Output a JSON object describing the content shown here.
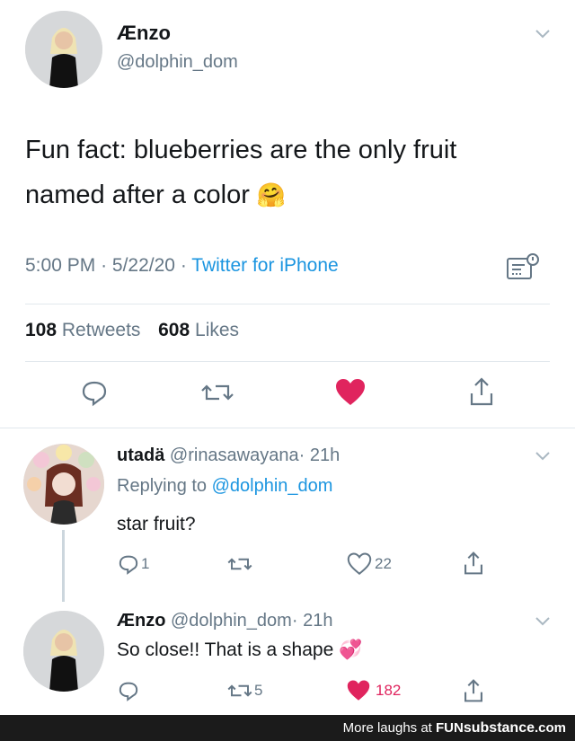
{
  "tweet": {
    "display_name": "Ænzo",
    "handle": "@dolphin_dom",
    "text_line1": "Fun fact: blueberries are the only fruit",
    "text_line2": "named after a color",
    "emoji": "🤗",
    "time": "5:00 PM",
    "sep1": "·",
    "date": "5/22/20",
    "sep2": "·",
    "source": "Twitter for iPhone",
    "retweets_count": "108",
    "retweets_label": "Retweets",
    "likes_count": "608",
    "likes_label": "Likes"
  },
  "replies": [
    {
      "name": "utadä",
      "handle": "@rinasawayana",
      "sep": "·",
      "time": "21h",
      "replying_prefix": "Replying to",
      "replying_handle": "@dolphin_dom",
      "text": "star fruit?",
      "reply_count": "1",
      "like_count": "22"
    },
    {
      "name": "Ænzo",
      "handle": "@dolphin_dom",
      "sep": "·",
      "time": "21h",
      "text": "So close!! That is a shape",
      "emoji": "💞",
      "retweet_count": "5",
      "like_count": "182"
    }
  ],
  "footer": {
    "prefix": "More laughs at ",
    "brand_fun": "FUN",
    "brand_substance": "substance",
    "brand_com": ".com"
  },
  "colors": {
    "like_red": "#e0245e",
    "link_blue": "#1b95e0",
    "muted_gray": "#657786",
    "footer_bg": "#1b1b1b"
  },
  "icons": [
    "chevron-down-icon",
    "reply-icon",
    "retweet-icon",
    "heart-icon",
    "share-icon",
    "analytics-icon"
  ]
}
